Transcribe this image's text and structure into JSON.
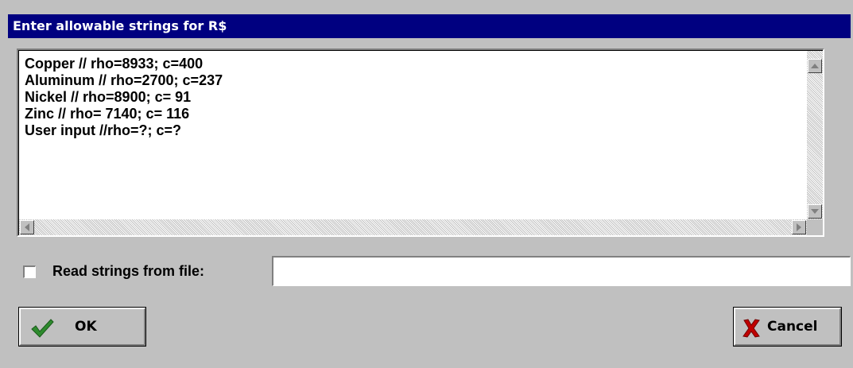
{
  "dialog": {
    "title": "Enter allowable strings for R$"
  },
  "listbox": {
    "lines": [
      "Copper // rho=8933; c=400",
      "Aluminum // rho=2700; c=237",
      "Nickel // rho=8900; c= 91",
      "Zinc // rho= 7140; c= 116",
      "User input //rho=?; c=?"
    ]
  },
  "read_from_file": {
    "checked": false,
    "label": "Read strings from file:",
    "value": ""
  },
  "buttons": {
    "ok_label": "OK",
    "cancel_label": "Cancel"
  },
  "icons": {
    "ok": "checkmark-icon",
    "cancel": "x-icon",
    "scroll_up": "arrow-up-icon",
    "scroll_down": "arrow-down-icon",
    "scroll_left": "arrow-left-icon",
    "scroll_right": "arrow-right-icon"
  },
  "colors": {
    "titlebar": "#000080",
    "face": "#c0c0c0",
    "check_green": "#2e8b2e",
    "cancel_red": "#c00000"
  }
}
